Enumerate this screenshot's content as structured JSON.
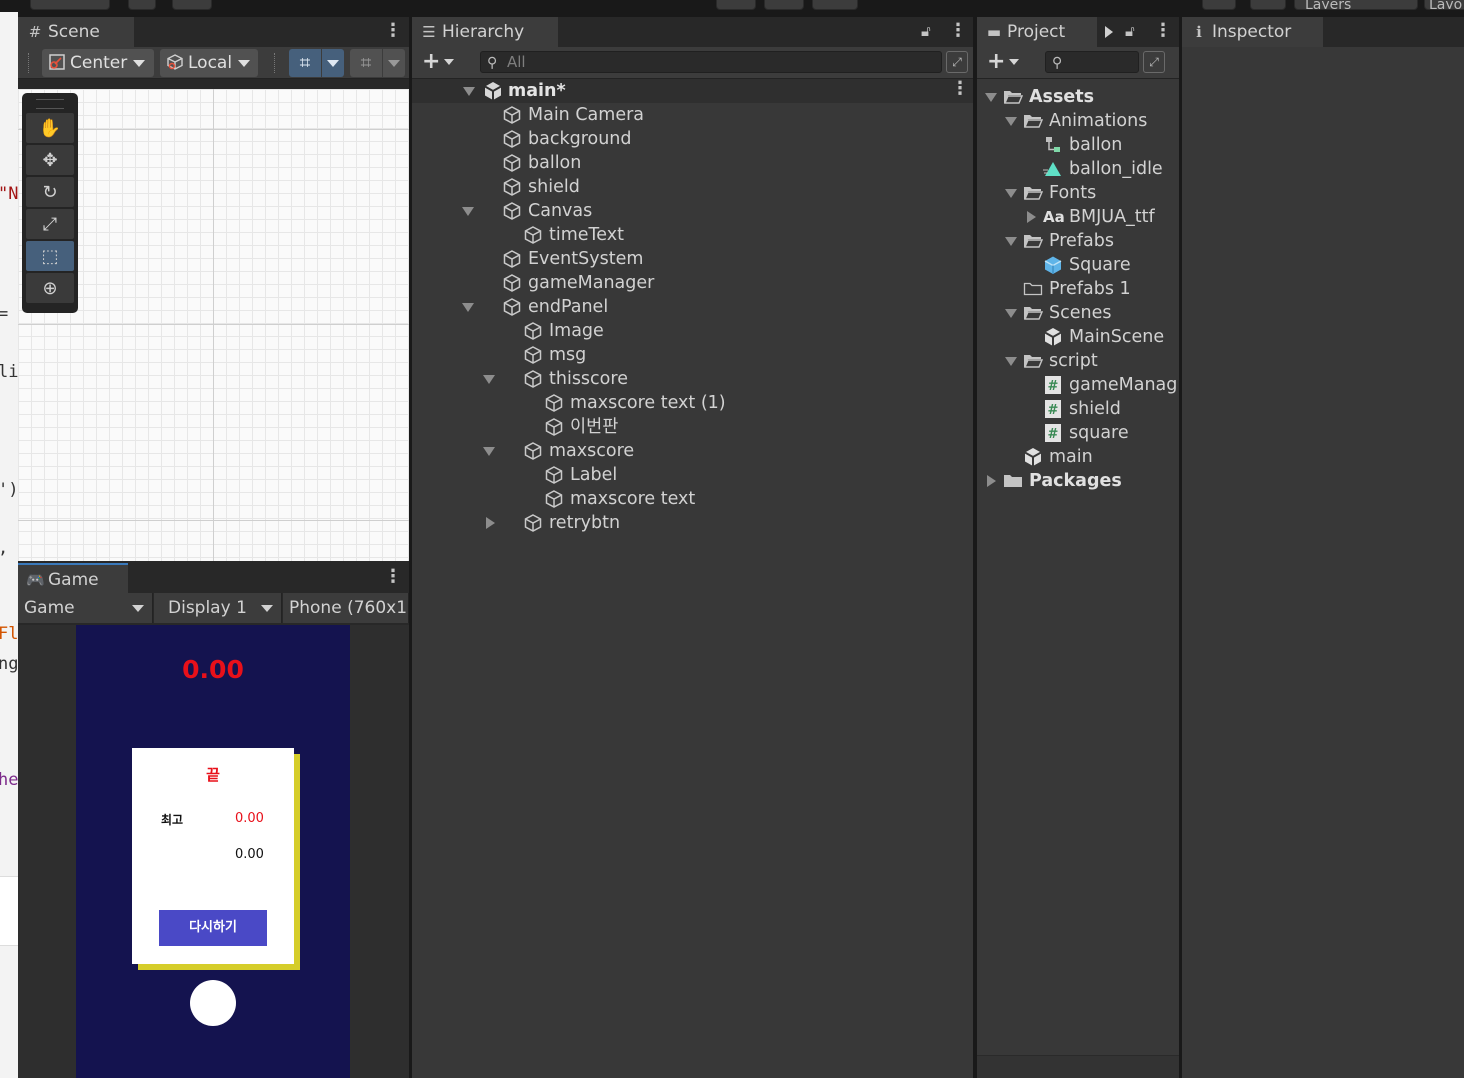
{
  "scene": {
    "tab": "Scene",
    "pivot_label": "Center",
    "space_label": "Local",
    "tools": [
      "hand-tool",
      "move-tool",
      "rotate-tool",
      "scale-tool",
      "rect-tool",
      "transform-tool"
    ]
  },
  "game": {
    "tab": "Game",
    "mode": "Game",
    "display": "Display 1",
    "resolution": "Phone (760x1",
    "timer": "0.00",
    "end_message": "끝",
    "best_label": "최고",
    "best_value": "0.00",
    "current_value": "0.00",
    "retry_label": "다시하기"
  },
  "hierarchy": {
    "tab": "Hierarchy",
    "search_placeholder": "All",
    "scene_name": "main*",
    "items": [
      {
        "label": "Main Camera",
        "depth": 1
      },
      {
        "label": "background",
        "depth": 1
      },
      {
        "label": "ballon",
        "depth": 1
      },
      {
        "label": "shield",
        "depth": 1
      },
      {
        "label": "Canvas",
        "depth": 1
      },
      {
        "label": "timeText",
        "depth": 2
      },
      {
        "label": "EventSystem",
        "depth": 1
      },
      {
        "label": "gameManager",
        "depth": 1
      },
      {
        "label": "endPanel",
        "depth": 1
      },
      {
        "label": "Image",
        "depth": 2
      },
      {
        "label": "msg",
        "depth": 2
      },
      {
        "label": "thisscore",
        "depth": 2
      },
      {
        "label": "maxscore text (1)",
        "depth": 3
      },
      {
        "label": "이번판",
        "depth": 3
      },
      {
        "label": "maxscore",
        "depth": 2
      },
      {
        "label": "Label",
        "depth": 3
      },
      {
        "label": "maxscore text",
        "depth": 3
      },
      {
        "label": "retrybtn",
        "depth": 2
      }
    ]
  },
  "project": {
    "tab": "Project",
    "items": [
      {
        "label": "Assets",
        "depth": 0
      },
      {
        "label": "Animations",
        "depth": 1
      },
      {
        "label": "ballon",
        "depth": 2
      },
      {
        "label": "ballon_idle",
        "depth": 2
      },
      {
        "label": "Fonts",
        "depth": 1
      },
      {
        "label": "BMJUA_ttf",
        "depth": 2
      },
      {
        "label": "Prefabs",
        "depth": 1
      },
      {
        "label": "Square",
        "depth": 2
      },
      {
        "label": "Prefabs 1",
        "depth": 1
      },
      {
        "label": "Scenes",
        "depth": 1
      },
      {
        "label": "MainScene",
        "depth": 2
      },
      {
        "label": "script",
        "depth": 1
      },
      {
        "label": "gameManag",
        "depth": 2
      },
      {
        "label": "shield",
        "depth": 2
      },
      {
        "label": "square",
        "depth": 2
      },
      {
        "label": "main",
        "depth": 1
      },
      {
        "label": "Packages",
        "depth": 0
      }
    ]
  },
  "inspector": {
    "tab": "Inspector"
  },
  "toolbar": {
    "layers_label": "Layers",
    "layout_label": "Layo"
  },
  "code_fragments": [
    "\"N",
    "=",
    "liv",
    "')",
    ", a",
    "Flo",
    "ng",
    "he"
  ],
  "colors": {
    "timer": "#e8101a",
    "game_bg": "#14134f",
    "retry_button": "#4a49c6",
    "panel_shadow": "#d5cd2a"
  }
}
